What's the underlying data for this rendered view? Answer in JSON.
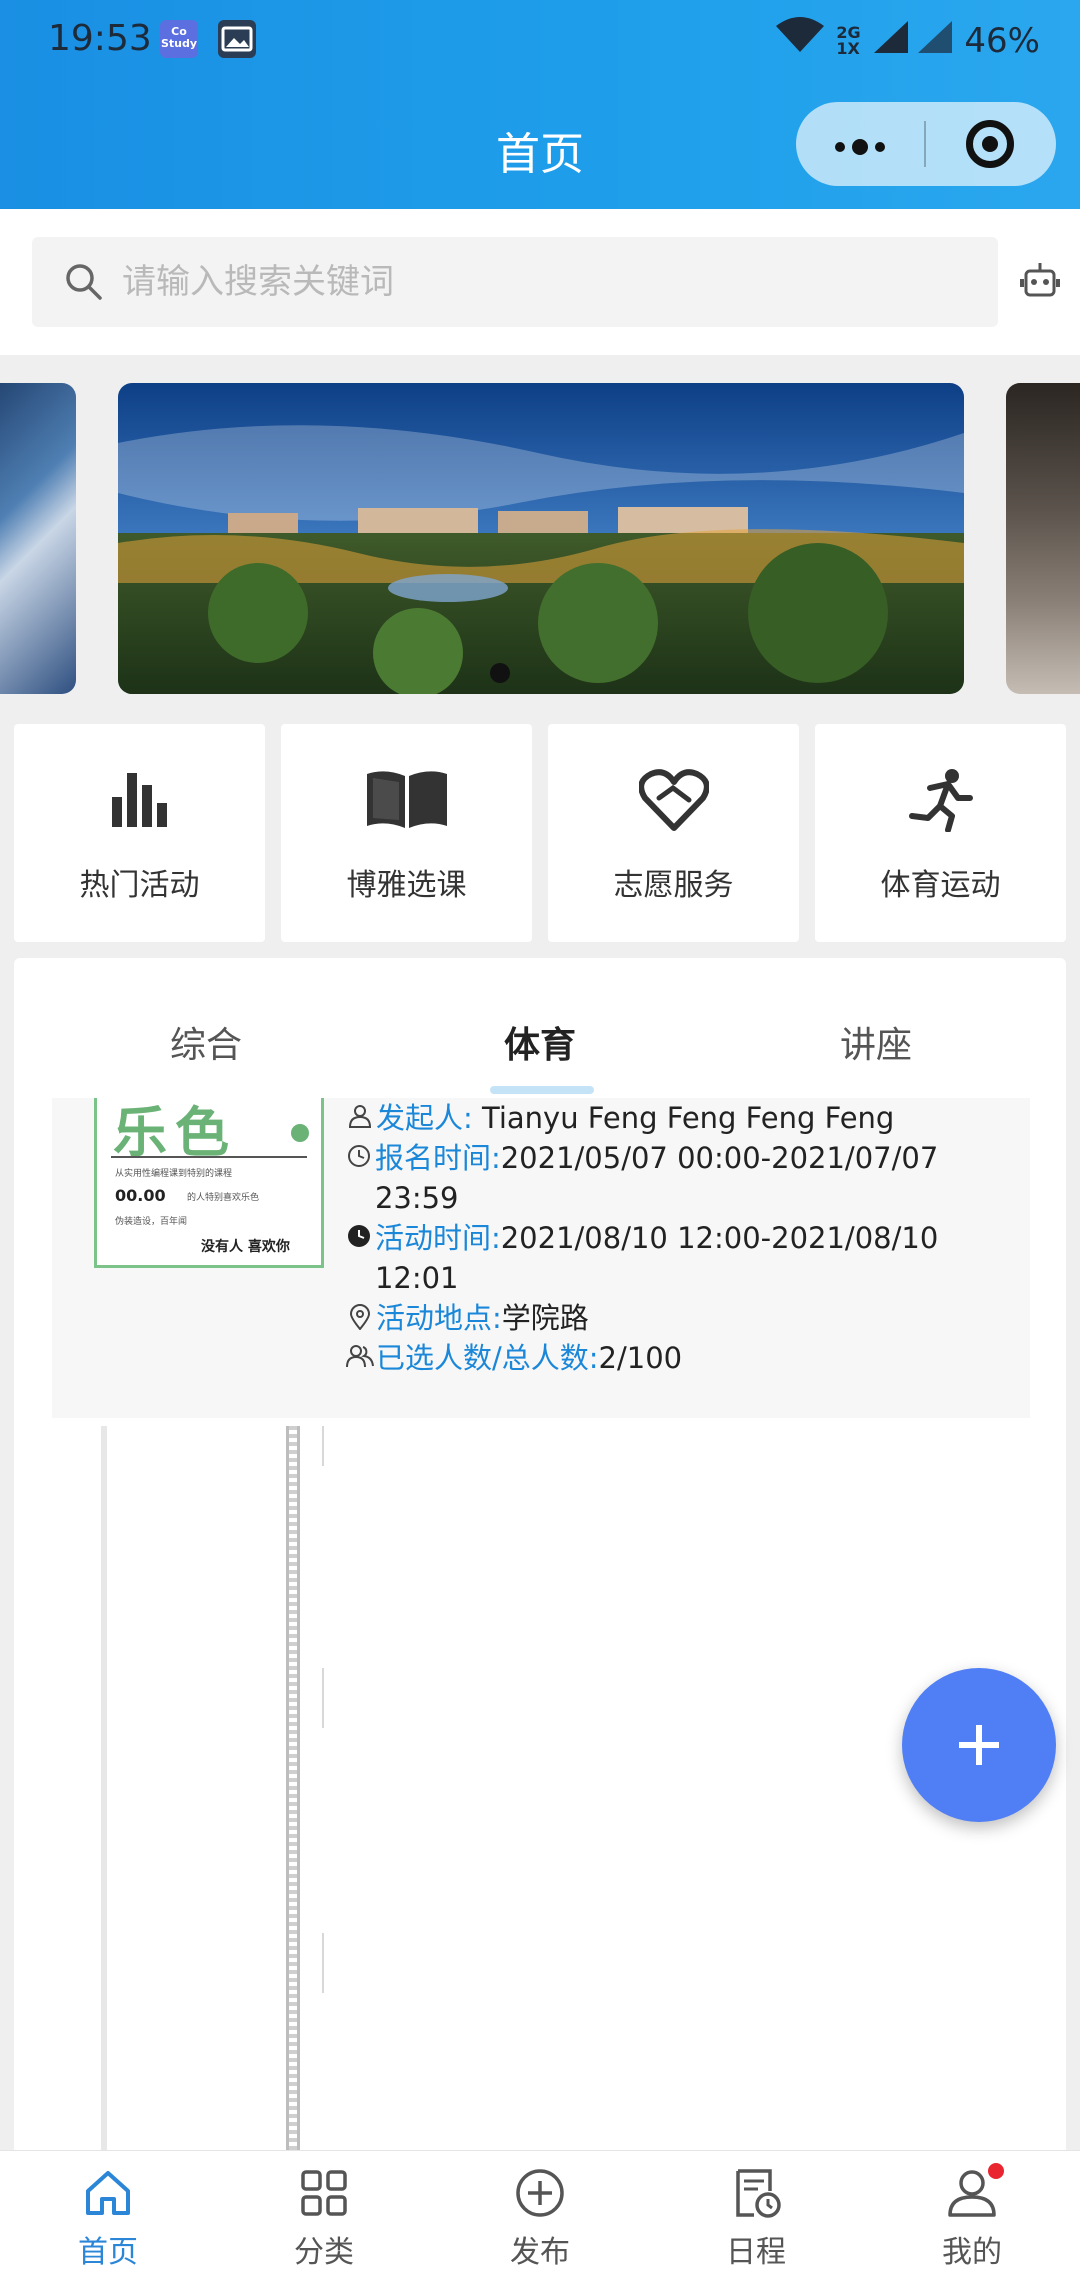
{
  "status_bar": {
    "time": "19:53",
    "network": "2G 1X",
    "battery": "46%",
    "app_icon_1": "Co Study"
  },
  "header": {
    "title": "首页"
  },
  "search": {
    "placeholder": "请输入搜索关键词"
  },
  "quick_entries": [
    {
      "label": "热门活动",
      "icon": "bar-chart-icon"
    },
    {
      "label": "博雅选课",
      "icon": "book-icon"
    },
    {
      "label": "志愿服务",
      "icon": "heart-hand-icon"
    },
    {
      "label": "体育运动",
      "icon": "runner-icon"
    }
  ],
  "tabs": [
    {
      "label": "综合",
      "active": false
    },
    {
      "label": "体育",
      "active": true
    },
    {
      "label": "讲座",
      "active": false
    }
  ],
  "activity": {
    "thumb_title": "乐色",
    "thumb_line1": "从实用性编程课到特别的课程",
    "thumb_num": "00.00",
    "thumb_line2": "的人特别喜欢乐色",
    "thumb_line3": "伪装造设，百年闻",
    "thumb_sig": "没有人 喜欢你",
    "organizer_label": "发起人:",
    "organizer": " Tianyu Feng Feng Feng Feng",
    "signup_label": "报名时间:",
    "signup_time": "2021/05/07 00:00-2021/07/07 23:59",
    "event_label": "活动时间:",
    "event_time": "2021/08/10 12:00-2021/08/10 12:01",
    "location_label": "活动地点:",
    "location": "学院路",
    "count_label": "已选人数/总人数:",
    "count": "2/100"
  },
  "bottom_nav": [
    {
      "label": "首页",
      "active": true
    },
    {
      "label": "分类",
      "active": false
    },
    {
      "label": "发布",
      "active": false
    },
    {
      "label": "日程",
      "active": false
    },
    {
      "label": "我的",
      "active": false
    }
  ],
  "colors": {
    "header": "#1e9eea",
    "accent": "#1b87d8",
    "fab": "#4f7ef5",
    "badge": "#e9252f"
  }
}
